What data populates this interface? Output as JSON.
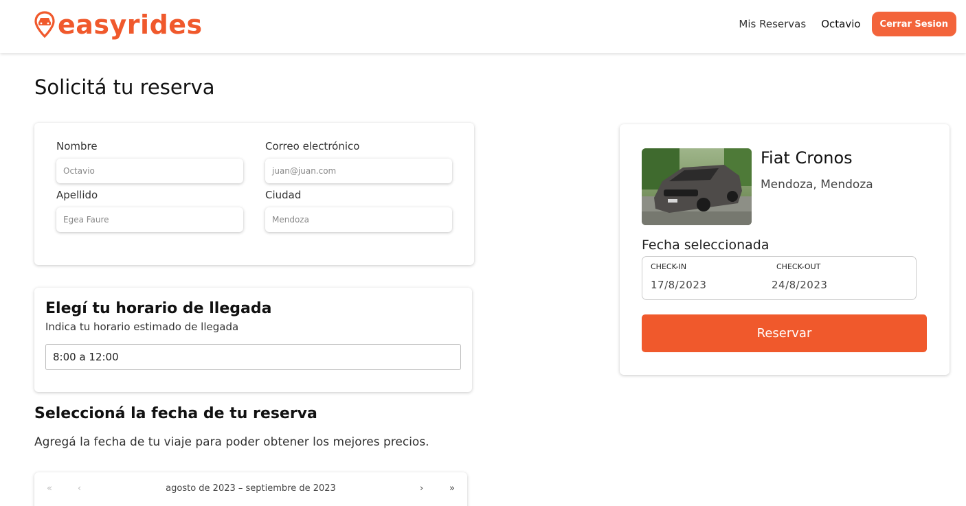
{
  "header": {
    "logo_text": "easyrides",
    "nav_reservations": "Mis Reservas",
    "user_name": "Octavio",
    "logout_label": "Cerrar Sesion"
  },
  "page_title": "Solicitá tu reserva",
  "form": {
    "first_name_label": "Nombre",
    "first_name_value": "Octavio",
    "email_label": "Correo electrónico",
    "email_value": "juan@juan.com",
    "last_name_label": "Apellido",
    "last_name_value": "Egea Faure",
    "city_label": "Ciudad",
    "city_value": "Mendoza"
  },
  "arrival": {
    "title": "Elegí tu horario de llegada",
    "subtitle": "Indica tu horario estimado de llegada",
    "selected": "8:00 a 12:00"
  },
  "date_section": {
    "title": "Seleccioná la fecha de tu reserva",
    "subtitle": "Agregá la fecha de tu viaje para poder obtener los mejores precios."
  },
  "calendar": {
    "prev_year": "«",
    "prev_month": "‹",
    "range_label": "agosto de 2023 – septiembre de 2023",
    "next_month": "›",
    "next_year": "»"
  },
  "summary": {
    "car_name": "Fiat Cronos",
    "location": "Mendoza, Mendoza",
    "selected_date_label": "Fecha seleccionada",
    "checkin_label": "CHECK-IN",
    "checkin_value": "17/8/2023",
    "checkout_label": "CHECK-OUT",
    "checkout_value": "24/8/2023",
    "reserve_label": "Reservar"
  },
  "colors": {
    "brand": "#f0592c",
    "button_light": "#f3643b"
  }
}
